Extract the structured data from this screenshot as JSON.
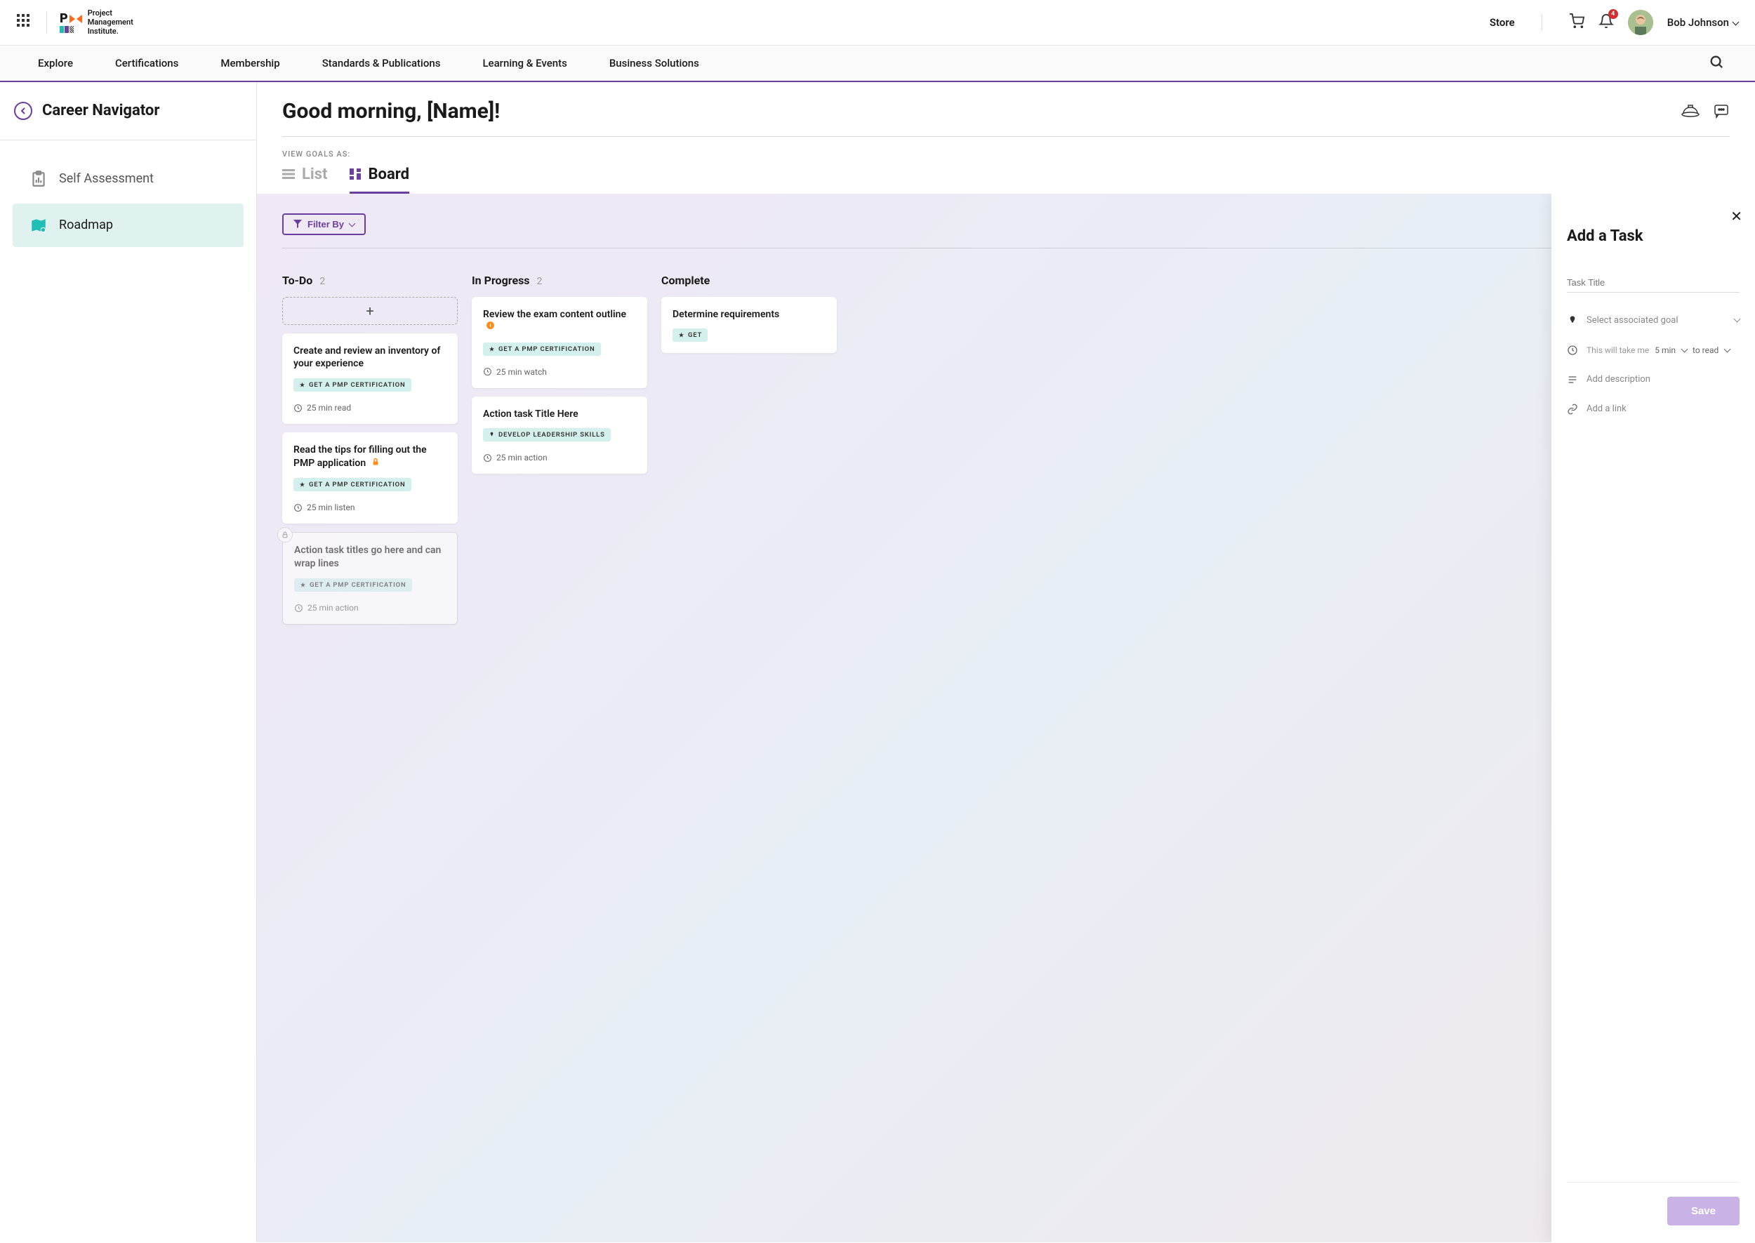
{
  "header": {
    "logo_text": "Project\nManagement\nInstitute.",
    "store": "Store",
    "notification_count": "4",
    "user_name": "Bob Johnson"
  },
  "nav": {
    "items": [
      "Explore",
      "Certifications",
      "Membership",
      "Standards & Publications",
      "Learning & Events",
      "Business Solutions"
    ]
  },
  "sidebar": {
    "title": "Career Navigator",
    "items": [
      {
        "label": "Self Assessment"
      },
      {
        "label": "Roadmap"
      }
    ]
  },
  "main": {
    "greeting": "Good morning, [Name]!",
    "view_label": "VIEW GOALS AS:",
    "tabs": {
      "list": "List",
      "board": "Board"
    },
    "filter": "Filter By"
  },
  "board": {
    "columns": [
      {
        "title": "To-Do",
        "count": "2",
        "cards": [
          {
            "title": "Create and review an inventory of your experience",
            "tag": "GET A PMP CERTIFICATION",
            "tag_icon": "star",
            "meta": "25 min read",
            "locked": false
          },
          {
            "title": "Read the tips for filling out the PMP application",
            "title_icon": "lock-orange",
            "tag": "GET A PMP CERTIFICATION",
            "tag_icon": "star",
            "meta": "25 min listen",
            "locked": false
          },
          {
            "title": "Action task titles go here and can wrap lines",
            "tag": "GET A PMP CERTIFICATION",
            "tag_icon": "star",
            "meta": "25 min action",
            "locked": true
          }
        ]
      },
      {
        "title": "In Progress",
        "count": "2",
        "cards": [
          {
            "title": "Review the exam content outline",
            "title_icon": "info-orange",
            "tag": "GET A PMP CERTIFICATION",
            "tag_icon": "star",
            "meta": "25 min watch",
            "locked": false
          },
          {
            "title": "Action task Title Here",
            "tag": "DEVELOP LEADERSHIP SKILLS",
            "tag_icon": "pin",
            "meta": "25 min action",
            "locked": false
          }
        ]
      },
      {
        "title": "Complete",
        "count": "",
        "cards": [
          {
            "title": "Determine requirements",
            "tag": "GET",
            "tag_icon": "star",
            "meta": "",
            "locked": false
          }
        ]
      }
    ]
  },
  "panel": {
    "title": "Add a Task",
    "task_title_placeholder": "Task Title",
    "goal_select": "Select associated goal",
    "time_prefix": "This will take me",
    "time_value": "5 min",
    "time_mode": "to read",
    "desc_placeholder": "Add description",
    "link_placeholder": "Add a link",
    "save": "Save"
  }
}
